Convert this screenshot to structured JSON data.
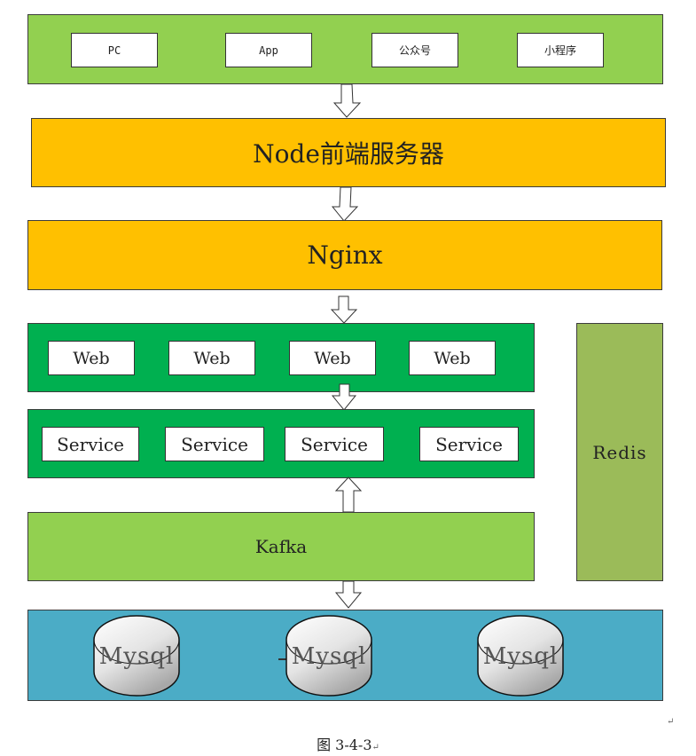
{
  "diagram": {
    "clients_layer": {
      "color": "#92d050",
      "items": [
        "PC",
        "App",
        "公众号",
        "小程序"
      ]
    },
    "node_layer": {
      "label": "Node前端服务器",
      "color": "#ffc000"
    },
    "nginx_layer": {
      "label": "Nginx",
      "color": "#ffc000"
    },
    "web_layer": {
      "color": "#00b050",
      "items": [
        "Web",
        "Web",
        "Web",
        "Web"
      ]
    },
    "service_layer": {
      "color": "#00b050",
      "items": [
        "Service",
        "Service",
        "Service",
        "Service"
      ]
    },
    "kafka_layer": {
      "label": "Kafka",
      "color": "#92d050"
    },
    "redis": {
      "label": "Redis",
      "color": "#9bbb59"
    },
    "db_layer": {
      "color": "#4bacc6",
      "items": [
        "Mysql",
        "Mysql",
        "Mysql"
      ]
    },
    "caption": "图 3-4-3",
    "paragraph_mark": "↵"
  }
}
